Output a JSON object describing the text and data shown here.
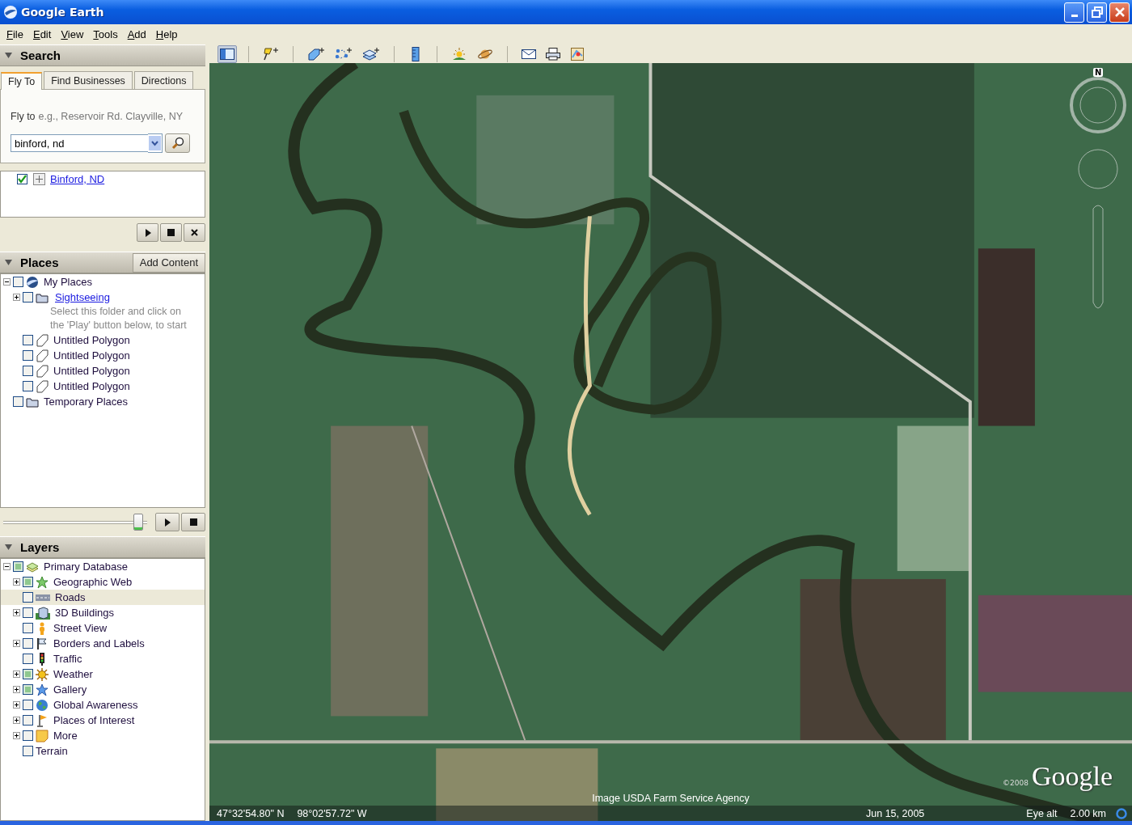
{
  "window": {
    "title": "Google Earth"
  },
  "menu": [
    {
      "label": "File"
    },
    {
      "label": "Edit"
    },
    {
      "label": "View"
    },
    {
      "label": "Tools"
    },
    {
      "label": "Add"
    },
    {
      "label": "Help"
    }
  ],
  "toolbar": [
    {
      "selected": true
    },
    {
      "selected": false
    },
    {
      "selected": false
    },
    {
      "selected": false
    },
    {
      "selected": false
    },
    {
      "selected": false
    },
    {
      "selected": false
    },
    {
      "selected": false
    },
    {
      "selected": false
    },
    {
      "selected": false
    },
    {
      "selected": false
    }
  ],
  "search": {
    "title": "Search",
    "tabs": [
      {
        "label": "Fly To",
        "selected": true
      },
      {
        "label": "Find Businesses",
        "selected": false
      },
      {
        "label": "Directions",
        "selected": false
      }
    ],
    "prompt": "Fly to",
    "example": "e.g., Reservoir Rd. Clayville, NY",
    "query": "binford, nd",
    "results": [
      {
        "label": "Binford, ND",
        "checked": true
      }
    ]
  },
  "places": {
    "title": "Places",
    "add_button": "Add Content",
    "tour_speed": {
      "level": 0.96
    },
    "tree": [
      {
        "label": "My Places",
        "kind": "globe",
        "expanded": true,
        "checked": false,
        "children": [
          {
            "label": "Sightseeing",
            "kind": "tour",
            "expanded": false,
            "checked": false,
            "note": "Select this folder and click on the 'Play' button below, to start"
          },
          {
            "label": "Untitled Polygon",
            "kind": "polygon",
            "checked": false
          },
          {
            "label": "Untitled Polygon",
            "kind": "polygon",
            "checked": false
          },
          {
            "label": "Untitled Polygon",
            "kind": "polygon",
            "checked": false
          },
          {
            "label": "Untitled Polygon",
            "kind": "polygon",
            "checked": false
          }
        ]
      },
      {
        "label": "Temporary Places",
        "kind": "folder",
        "checked": false
      }
    ]
  },
  "layers": {
    "title": "Layers",
    "tree": [
      {
        "label": "Primary Database",
        "kind": "stack",
        "expanded": true,
        "checked": true,
        "selected": false,
        "children": [
          {
            "label": "Geographic Web",
            "kind": "star",
            "expanded": false,
            "checked": true,
            "selected": false
          },
          {
            "label": "Roads",
            "kind": "road",
            "checked": false,
            "selected": true
          },
          {
            "label": "3D Buildings",
            "kind": "building",
            "expanded": false,
            "checked": false,
            "selected": false
          },
          {
            "label": "Street View",
            "kind": "person",
            "checked": false,
            "selected": false
          },
          {
            "label": "Borders and Labels",
            "kind": "flag",
            "expanded": false,
            "checked": false,
            "selected": false
          },
          {
            "label": "Traffic",
            "kind": "traffic",
            "checked": false,
            "selected": false
          },
          {
            "label": "Weather",
            "kind": "sun",
            "expanded": false,
            "checked": true,
            "selected": false
          },
          {
            "label": "Gallery",
            "kind": "bluestar",
            "expanded": false,
            "checked": true,
            "selected": false
          },
          {
            "label": "Global Awareness",
            "kind": "earth",
            "expanded": false,
            "checked": false,
            "selected": false
          },
          {
            "label": "Places of Interest",
            "kind": "pin",
            "expanded": false,
            "checked": false,
            "selected": false
          },
          {
            "label": "More",
            "kind": "note",
            "expanded": false,
            "checked": false,
            "selected": false
          },
          {
            "label": "Terrain",
            "kind": "plain",
            "checked": false,
            "selected": false
          }
        ]
      }
    ]
  },
  "map": {
    "compass": "N",
    "attribution": "Image USDA Farm Service Agency",
    "copyright": "©2008",
    "logo": "Google",
    "latitude": "47°32'54.80\" N",
    "longitude": "98°02'57.72\" W",
    "date": "Jun 15, 2005",
    "eye_alt_label": "Eye alt",
    "eye_alt": "2.00 km"
  }
}
